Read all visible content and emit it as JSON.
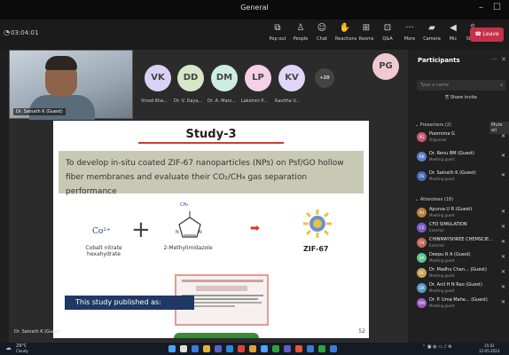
{
  "window": {
    "title": "General",
    "minimize": "–",
    "maximize": "☐"
  },
  "meeting": {
    "timer": "03:04:01"
  },
  "toolbar": {
    "buttons": [
      {
        "icon": "participants-icon",
        "glyph": "⧉",
        "label": "Pop out"
      },
      {
        "icon": "people-icon",
        "glyph": "♙",
        "label": "People"
      },
      {
        "icon": "chat-icon",
        "glyph": "☺",
        "label": "Chat"
      },
      {
        "icon": "reactions-icon",
        "glyph": "✋",
        "label": "Reactions"
      },
      {
        "icon": "rooms-icon",
        "glyph": "⊞",
        "label": "Rooms"
      },
      {
        "icon": "qa-icon",
        "glyph": "⊡",
        "label": "Q&A"
      },
      {
        "icon": "more-icon",
        "glyph": "···",
        "label": "More"
      },
      {
        "icon": "camera-icon",
        "glyph": "▰",
        "label": "Camera"
      },
      {
        "icon": "mic-icon",
        "glyph": "◀",
        "label": "Mic"
      },
      {
        "icon": "share-icon",
        "glyph": "⇪",
        "label": "Share"
      }
    ],
    "leave": "Leave"
  },
  "self_video": {
    "name": "Dr. Sainath K (Guest)"
  },
  "gallery": [
    {
      "initials": "VK",
      "label": "Vinod Kha...",
      "bg": "#d9d2f5",
      "fg": "#444"
    },
    {
      "initials": "DD",
      "label": "Dr. V. Daya...",
      "bg": "#d6e7c8",
      "fg": "#444"
    },
    {
      "initials": "DM",
      "label": "Dr. A. Mani...",
      "bg": "#cdeedf",
      "fg": "#444"
    },
    {
      "initials": "LP",
      "label": "Lakshmi P...",
      "bg": "#f5d0e6",
      "fg": "#444"
    },
    {
      "initials": "KV",
      "label": "Kavitha V...",
      "bg": "#e1d6f8",
      "fg": "#444"
    },
    {
      "initials": "+20",
      "label": "",
      "bg": "#444",
      "fg": "#ddd"
    },
    {
      "initials": "PG",
      "label": "",
      "bg": "#f1c9d1",
      "fg": "#444"
    }
  ],
  "slide": {
    "title": "Study-3",
    "objective": "To develop in-situ coated ZIF-67 nanoparticles (NPs) on Psf/GO hollow fiber membranes and evaluate their CO₂/CH₄ gas separation performance",
    "cobalt_formula": "Co²⁺",
    "cobalt_name": "Cobalt nitrate hexahydrate",
    "plus": "+",
    "methyl_label": "CH₃",
    "imidazole_name": "2-Methylimidazole",
    "arrow": "➡",
    "product": "ZIF-67",
    "published": "This study published as:",
    "page": "52"
  },
  "presenter_bottom": {
    "name": "Dr. Sainath K (Guest)"
  },
  "participants": {
    "title": "Participants",
    "search_placeholder": "Type a name",
    "share_invite": "Share invite",
    "presenters_header": "Presenters (2)",
    "mute_all": "Mute all",
    "attendees_header": "Attendees (18)",
    "rows": [
      {
        "initials": "PG",
        "name": "Poornima G",
        "status": "Organizer",
        "color": "#c75b75",
        "section": "p"
      },
      {
        "initials": "DK",
        "name": "Dr. Renu BM (Guest)",
        "status": "Meeting guest",
        "color": "#5b7ec7",
        "section": "p"
      },
      {
        "initials": "DS",
        "name": "Dr. Sainath K (Guest)",
        "status": "Meeting guest",
        "color": "#4a6ab5",
        "section": "p"
      },
      {
        "initials": "AU",
        "name": "Apurva U R (Guest)",
        "status": "Meeting guest",
        "color": "#b7823e",
        "section": "a"
      },
      {
        "initials": "CS",
        "name": "CFD SIMULATION",
        "status": "External",
        "color": "#7c5bc7",
        "section": "a"
      },
      {
        "initials": "CH",
        "name": "CHINMAYSHREE CHEMSCIE...",
        "status": "External",
        "color": "#c76a5b",
        "section": "a"
      },
      {
        "initials": "DA",
        "name": "Deepu R A (Guest)",
        "status": "Meeting guest",
        "color": "#5bc78c",
        "section": "a"
      },
      {
        "initials": "DC",
        "name": "Dr. Madhu Chan... (Guest)",
        "status": "Meeting guest",
        "color": "#c7a55b",
        "section": "a"
      },
      {
        "initials": "DR",
        "name": "Dr. Anil H N Rao (Guest)",
        "status": "Meeting guest",
        "color": "#5b9ac7",
        "section": "a"
      },
      {
        "initials": "DM",
        "name": "Dr. P. Uma Mahe... (Guest)",
        "status": "Meeting guest",
        "color": "#9a5bc7",
        "section": "a"
      }
    ]
  },
  "taskbar": {
    "weather": "29°C",
    "weather_desc": "Cloudy",
    "time": "15:02",
    "date": "12-05-2023"
  }
}
